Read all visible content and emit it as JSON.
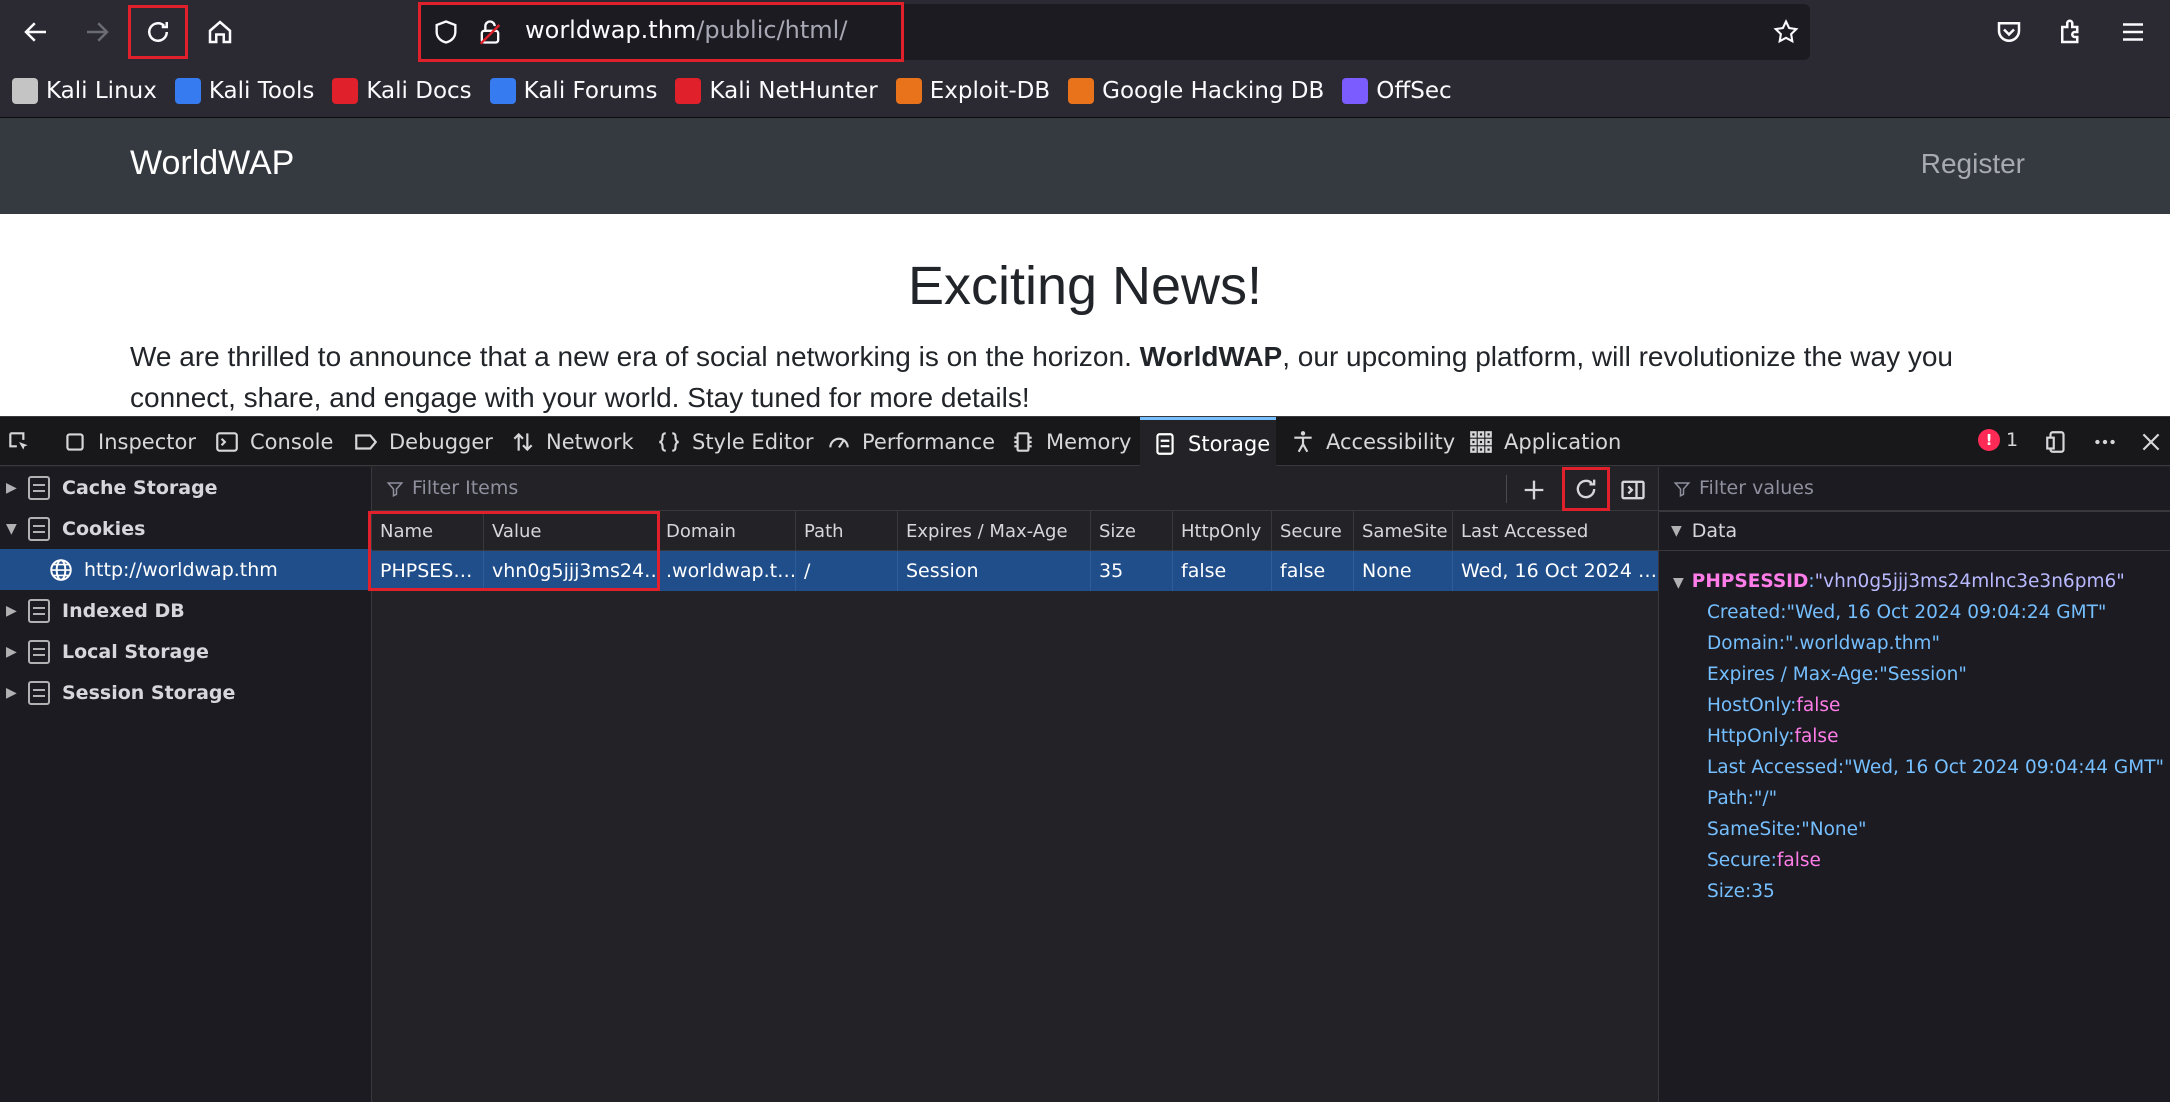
{
  "browser": {
    "url_host": "worldwap.thm",
    "url_path": "/public/html/",
    "bookmarks": [
      {
        "label": "Kali Linux",
        "icon": "kali-dragon-icon",
        "color": "#c4c4c4"
      },
      {
        "label": "Kali Tools",
        "icon": "kali-tools-icon",
        "color": "#367bf0"
      },
      {
        "label": "Kali Docs",
        "icon": "kali-docs-icon",
        "color": "#e0202b"
      },
      {
        "label": "Kali Forums",
        "icon": "kali-forums-icon",
        "color": "#367bf0"
      },
      {
        "label": "Kali NetHunter",
        "icon": "kali-nethunter-icon",
        "color": "#e0202b"
      },
      {
        "label": "Exploit-DB",
        "icon": "exploit-db-icon",
        "color": "#e8731b"
      },
      {
        "label": "Google Hacking DB",
        "icon": "ghdb-icon",
        "color": "#e8731b"
      },
      {
        "label": "OffSec",
        "icon": "offsec-icon",
        "color": "#7a5cff"
      }
    ]
  },
  "site": {
    "brand": "WorldWAP",
    "register": "Register",
    "headline": "Exciting News!",
    "para_before": "We are thrilled to announce that a new era of social networking is on the horizon. ",
    "para_bold": "WorldWAP",
    "para_after": ", our upcoming platform, will revolutionize the way you connect, share, and engage with your world. Stay tuned for more details!"
  },
  "devtools": {
    "tabs": [
      "Inspector",
      "Console",
      "Debugger",
      "Network",
      "Style Editor",
      "Performance",
      "Memory",
      "Storage",
      "Accessibility",
      "Application"
    ],
    "active_tab": "Storage",
    "error_count": "1",
    "tree": {
      "cache_storage": "Cache Storage",
      "cookies": "Cookies",
      "cookie_host": "http://worldwap.thm",
      "indexed_db": "Indexed DB",
      "local_storage": "Local Storage",
      "session_storage": "Session Storage"
    },
    "filter_items_placeholder": "Filter Items",
    "filter_values_placeholder": "Filter values",
    "columns": [
      "Name",
      "Value",
      "Domain",
      "Path",
      "Expires / Max-Age",
      "Size",
      "HttpOnly",
      "Secure",
      "SameSite",
      "Last Accessed"
    ],
    "row": [
      "PHPSES…",
      "vhn0g5jjj3ms24…",
      ".worldwap.t…",
      "/",
      "Session",
      "35",
      "false",
      "false",
      "None",
      "Wed, 16 Oct 2024 …"
    ],
    "data": {
      "header": "Data",
      "root_key": "PHPSESSID",
      "root_val": "\"vhn0g5jjj3ms24mlnc3e3n6pm6\"",
      "created_key": "Created",
      "created_val": "\"Wed, 16 Oct 2024 09:04:24 GMT\"",
      "domain_key": "Domain",
      "domain_val": "\".worldwap.thm\"",
      "expires_key": "Expires / Max-Age",
      "expires_val": "\"Session\"",
      "hostonly_key": "HostOnly",
      "hostonly_val": "false",
      "httponly_key": "HttpOnly",
      "httponly_val": "false",
      "lastacc_key": "Last Accessed",
      "lastacc_val": "\"Wed, 16 Oct 2024 09:04:44 GMT\"",
      "path_key": "Path",
      "path_val": "\"/\"",
      "samesite_key": "SameSite",
      "samesite_val": "\"None\"",
      "secure_key": "Secure",
      "secure_val": "false",
      "size_key": "Size",
      "size_val": "35"
    }
  }
}
